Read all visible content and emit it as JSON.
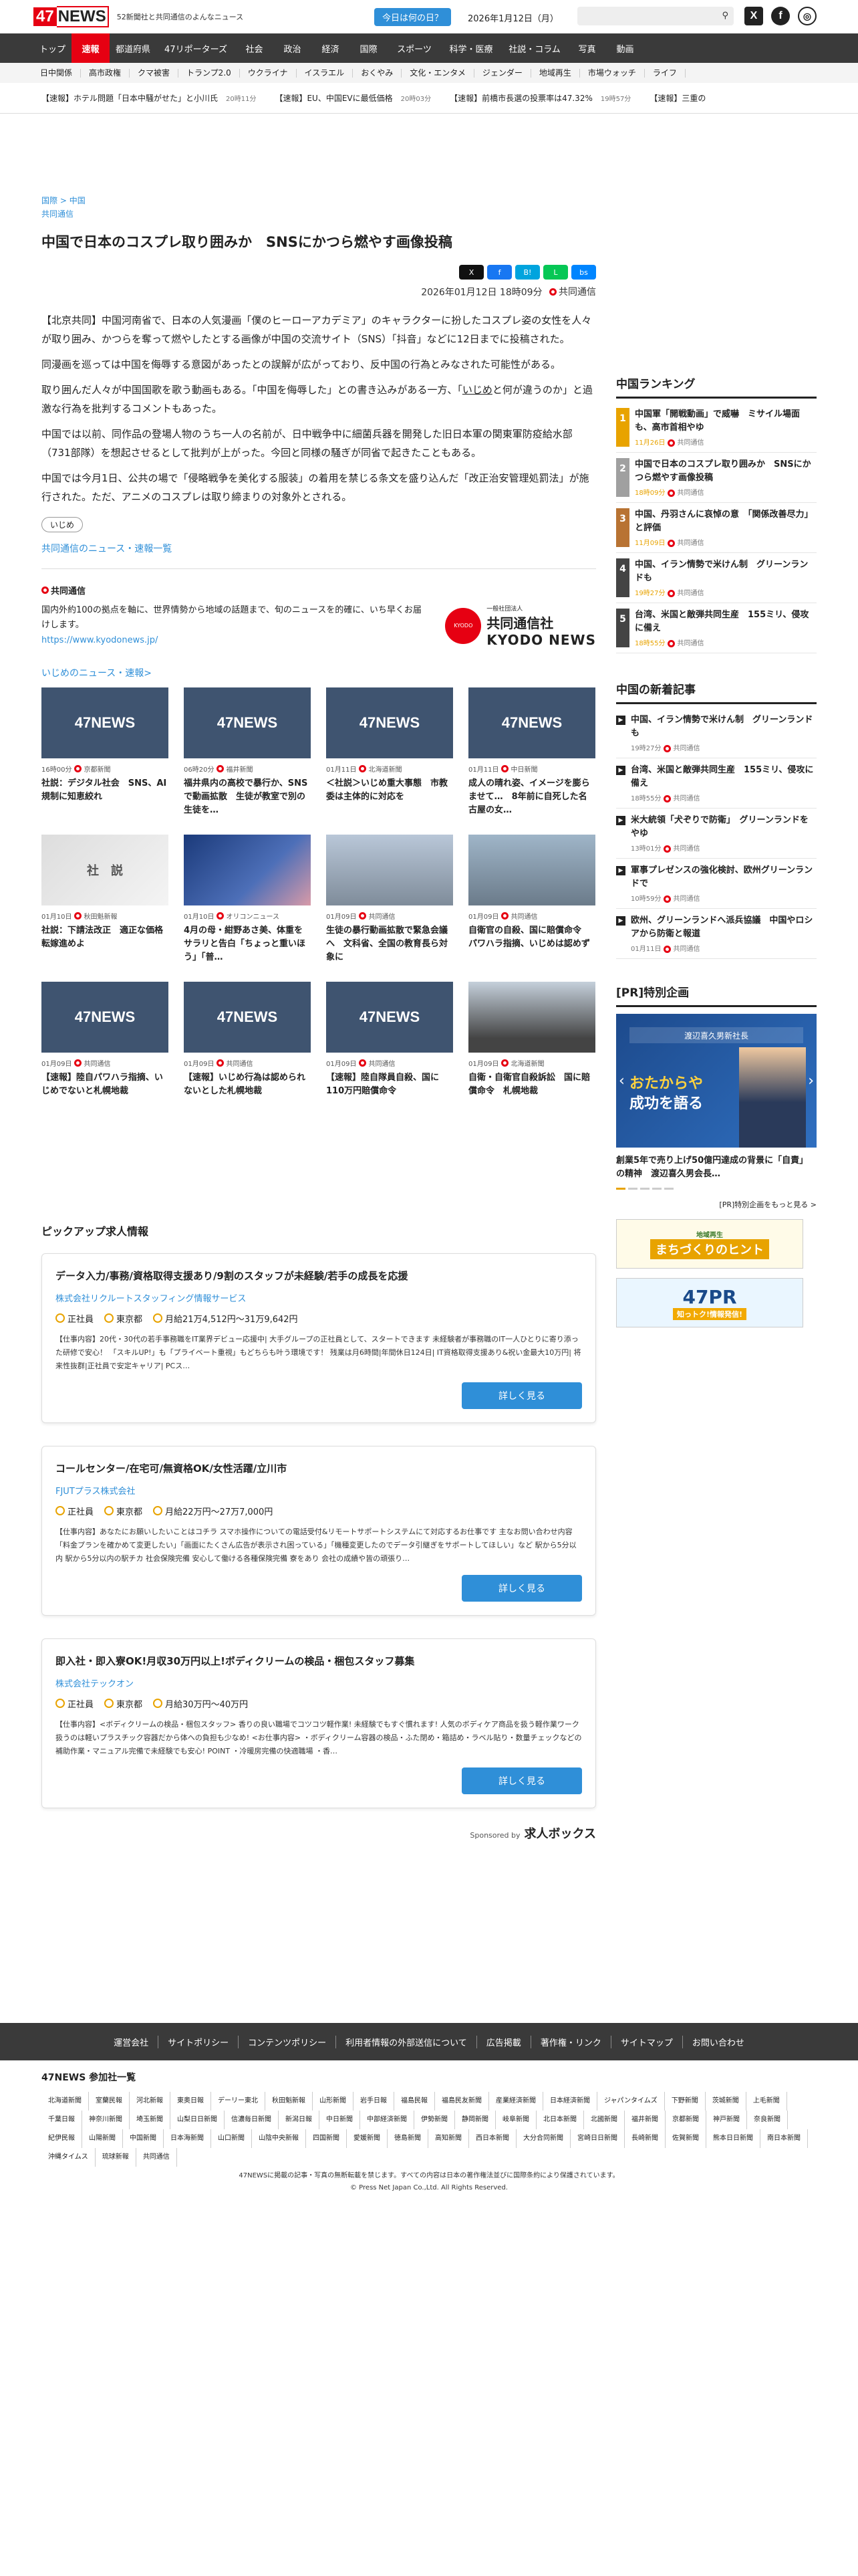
{
  "header": {
    "logo_num": "47",
    "logo_text": "NEWS",
    "tagline": "52新聞社と共同通信のよんなニュース",
    "day_button": "今日は何の日？",
    "date": "2026年1月12日（月）",
    "x_label": "X",
    "fb_label": "f"
  },
  "nav": [
    "トップ",
    "速報",
    "都道府県",
    "47リポーターズ",
    "社会",
    "政治",
    "経済",
    "国際",
    "スポーツ",
    "科学・医療",
    "社説・コラム",
    "写真",
    "動画"
  ],
  "subnav": [
    "日中関係",
    "高市政権",
    "クマ被害",
    "トランプ2.0",
    "ウクライナ",
    "イスラエル",
    "おくやみ",
    "文化・エンタメ",
    "ジェンダー",
    "地域再生",
    "市場ウォッチ",
    "ライフ"
  ],
  "ticker": [
    {
      "text": "【速報】ホテル問題「日本中騒がせた」と小川氏",
      "time": "20時11分"
    },
    {
      "text": "【速報】EU、中国EVに最低価格",
      "time": "20時03分"
    },
    {
      "text": "【速報】前橋市長選の投票率は47.32%",
      "time": "19時57分"
    },
    {
      "text": "【速報】三重の",
      "time": ""
    }
  ],
  "article": {
    "breadcrumb1": "国際",
    "breadcrumb_sep": ">",
    "breadcrumb2": "中国",
    "source_link": "共同通信",
    "title": "中国で日本のコスプレ取り囲みか　SNSにかつら燃やす画像投稿",
    "date": "2026年01月12日 18時09分",
    "agency": "共同通信",
    "share_x": "X",
    "share_fb": "f",
    "share_hb": "B!",
    "share_line": "L",
    "share_bs": "bs",
    "p1": "【北京共同】中国河南省で、日本の人気漫画「僕のヒーローアカデミア」のキャラクターに扮したコスプレ姿の女性を人々が取り囲み、かつらを奪って燃やしたとする画像が中国の交流サイト（SNS）「抖音」などに12日までに投稿された。",
    "p2": "同漫画を巡っては中国を侮辱する意図があったとの誤解が広がっており、反中国の行為とみなされた可能性がある。",
    "p3a": "取り囲んだ人々が中国国歌を歌う動画もある。「中国を侮辱した」との書き込みがある一方、「",
    "p3u": "いじめ",
    "p3b": "と何が違うのか」と過激な行為を批判するコメントもあった。",
    "p4": "中国では以前、同作品の登場人物のうち一人の名前が、日中戦争中に細菌兵器を開発した旧日本軍の関東軍防疫給水部（731部隊）を想起させるとして批判が上がった。今回と同様の騒ぎが同省で起きたこともある。",
    "p5": "中国では今月1日、公共の場で「侵略戦争を美化する服装」の着用を禁じる条文を盛り込んだ「改正治安管理処罰法」が施行された。ただ、アニメのコスプレは取り締まりの対象外とされる。",
    "keyword": "いじめ",
    "ky_news_link": "共同通信のニュース・速報一覧"
  },
  "kyodo": {
    "name": "共同通信",
    "desc": "国内外約100の拠点を軸に、世界情勢から地域の話題まで、旬のニュースを的確に、いち早くお届けします。",
    "url": "https://www.kyodonews.jp/",
    "logo_circle": "KYODO",
    "logo_small": "一般社団法人",
    "logo_jp": "共同通信社",
    "logo_en": "KYODO NEWS"
  },
  "ijime": {
    "link": "いじめのニュース・速報>",
    "cards": [
      {
        "thumb": "47NEWS",
        "date": "16時00分",
        "src": "京都新聞",
        "title": "社説：デジタル社会　SNS、AI規制に知恵絞れ"
      },
      {
        "thumb": "47NEWS",
        "date": "06時20分",
        "src": "福井新聞",
        "title": "福井県内の高校で暴行か、SNSで動画拡散　生徒が教室で別の生徒を…"
      },
      {
        "thumb": "47NEWS",
        "date": "01月11日",
        "src": "北海道新聞",
        "title": "＜社説＞いじめ重大事態　市教委は主体的に対応を"
      },
      {
        "thumb": "47NEWS",
        "date": "01月11日",
        "src": "中日新聞",
        "title": "成人の晴れ姿、イメージを膨らませて…　8年前に自死した名古屋の女…"
      },
      {
        "thumb": "社　説",
        "date": "01月10日",
        "src": "秋田魁新報",
        "title": "社説：下請法改正　適正な価格転嫁進めよ"
      },
      {
        "thumb": "",
        "date": "01月10日",
        "src": "オリコンニュース",
        "title": "4月の母・紺野あさ美、体重をサラリと告白「ちょっと重いほう」「普…"
      },
      {
        "thumb": "",
        "date": "01月09日",
        "src": "共同通信",
        "title": "生徒の暴行動画拡散で緊急会議へ　文科省、全国の教育長ら対象に"
      },
      {
        "thumb": "",
        "date": "01月09日",
        "src": "共同通信",
        "title": "自衛官の自殺、国に賠償命令　パワハラ指摘、いじめは認めず"
      },
      {
        "thumb": "47NEWS",
        "date": "01月09日",
        "src": "共同通信",
        "title": "【速報】陸自パワハラ指摘、いじめでないと札幌地裁"
      },
      {
        "thumb": "47NEWS",
        "date": "01月09日",
        "src": "共同通信",
        "title": "【速報】いじめ行為は認められないとした札幌地裁"
      },
      {
        "thumb": "47NEWS",
        "date": "01月09日",
        "src": "共同通信",
        "title": "【速報】陸自隊員自殺、国に110万円賠償命令"
      },
      {
        "thumb": "",
        "date": "01月09日",
        "src": "北海道新聞",
        "title": "自衛・自衛官自殺訴訟　国に賠償命令　札幌地裁"
      }
    ]
  },
  "jobs": {
    "heading": "ピックアップ求人情報",
    "items": [
      {
        "title": "データ入力/事務/資格取得支援あり/9割のスタッフが未経験/若手の成長を応援",
        "company": "株式会社リクルートスタッフィング情報サービス",
        "type": "正社員",
        "place": "東京都",
        "salary": "月給21万4,512円〜31万9,642円",
        "desc": "【仕事内容】20代・30代の若手事務職をIT業界デビュー応援中| 大手グループの正社員として、スタートできます 未経験者が事務職のIT一人ひとりに寄り添った研修で安心！ 「スキルUP!」も「プライベート重視」もどちらも叶う環境です！ 残業は月6時間|年間休日124日| IT資格取得支援あり&祝い金最大10万円| 将来性抜群|正社員で安定キャリア| PCス…",
        "button": "詳しく見る"
      },
      {
        "title": "コールセンター/在宅可/無資格OK/女性活躍/立川市",
        "company": "FJUTプラス株式会社",
        "type": "正社員",
        "place": "東京都",
        "salary": "月給22万円〜27万7,000円",
        "desc": "【仕事内容】あなたにお願いしたいことはコチラ スマホ操作についての電話受付&リモートサポートシステムにて対応するお仕事です 主なお問い合わせ内容「料金プランを確かめて変更したい」「画面にたくさん広告が表示され困っている」「機種変更したのでデータ引継ぎをサポートしてほしい」など 駅から5分以内 駅から5分以内の駅チカ 社会保険完備 安心して働ける各種保険完備 寮をあり 会社の成績や皆の頑張り…",
        "button": "詳しく見る"
      },
      {
        "title": "即入社・即入寮OK!月収30万円以上!ボディクリームの検品・梱包スタッフ募集",
        "company": "株式会社テックオン",
        "type": "正社員",
        "place": "東京都",
        "salary": "月給30万円〜40万円",
        "desc": "【仕事内容】<ボディクリームの検品・梱包スタッフ> 香りの良い職場でコツコツ軽作業! 未経験でもすぐ慣れます! 人気のボディケア商品を扱う軽作業ワーク 扱うのは軽いプラスチック容器だから体への負担も少なめ! <お仕事内容> ・ボディクリーム容器の検品・ふた閉め・箱詰め・ラベル貼り・数量チェックなどの補助作業・マニュアル完備で未経験でも安心! POINT ・冷暖房完備の快適職場 ・香…",
        "button": "詳しく見る"
      }
    ],
    "sponsored": "Sponsored by",
    "sponsor": "求人ボックス"
  },
  "ranking": {
    "heading": "中国ランキング",
    "items": [
      {
        "n": "1",
        "title": "中国軍「開戦動画」で威嚇　ミサイル場面も、高市首相やゆ",
        "date": "11月26日",
        "src": "共同通信",
        "color": "#e8a300"
      },
      {
        "n": "2",
        "title": "中国で日本のコスプレ取り囲みか　SNSにかつら燃やす画像投稿",
        "date": "18時09分",
        "src": "共同通信",
        "color": "#a0a0a0"
      },
      {
        "n": "3",
        "title": "中国、丹羽さんに哀悼の意　「関係改善尽力」と評価",
        "date": "11月09日",
        "src": "共同通信",
        "color": "#b87333"
      },
      {
        "n": "4",
        "title": "中国、イラン情勢で米けん制　グリーンランドも",
        "date": "19時27分",
        "src": "共同通信",
        "color": "#444"
      },
      {
        "n": "5",
        "title": "台湾、米国と敵弾共同生産　155ミリ、侵攻に備え",
        "date": "18時55分",
        "src": "共同通信",
        "color": "#444"
      }
    ]
  },
  "newest": {
    "heading": "中国の新着記事",
    "items": [
      {
        "title": "中国、イラン情勢で米けん制　グリーンランドも",
        "date": "19時27分",
        "src": "共同通信"
      },
      {
        "title": "台湾、米国と敵弾共同生産　155ミリ、侵攻に備え",
        "date": "18時55分",
        "src": "共同通信"
      },
      {
        "title": "米大統領「犬ぞりで防衛」　グリーンランドをやゆ",
        "date": "13時01分",
        "src": "共同通信"
      },
      {
        "title": "軍事プレゼンスの強化検討、欧州グリーンランドで",
        "date": "10時59分",
        "src": "共同通信"
      },
      {
        "title": "欧州、グリーンランドへ派兵協議　中国やロシアから防衛と報道",
        "date": "01月11日",
        "src": "共同通信"
      }
    ]
  },
  "pr": {
    "heading": "[PR]特別企画",
    "box_top": "渡辺喜久男新社長",
    "box_main1": "おたからや",
    "box_main2": "成功を語る",
    "caption": "創業5年で売り上げ50億円達成の背景に「自責」の精神　渡辺喜久男会長…",
    "more": "[PR]特別企画をもっと見る >",
    "banner1": "まちづくりのヒント",
    "banner1_sub": "地域再生",
    "banner2": "47PR",
    "banner2_sub": "知っトク!情報発信!"
  },
  "footer": {
    "links": [
      "運営会社",
      "サイトポリシー",
      "コンテンツポリシー",
      "利用者情報の外部送信について",
      "広告掲載",
      "著作権・リンク",
      "サイトマップ",
      "お問い合わせ"
    ],
    "pub_heading": "47NEWS 参加社一覧",
    "pubs": [
      "北海道新聞",
      "室蘭民報",
      "河北新報",
      "東奥日報",
      "デーリー東北",
      "秋田魁新報",
      "山形新聞",
      "岩手日報",
      "福島民報",
      "福島民友新聞",
      "産業経済新聞",
      "日本経済新聞",
      "ジャパンタイムズ",
      "下野新聞",
      "茨城新聞",
      "上毛新聞",
      "千葉日報",
      "神奈川新聞",
      "埼玉新聞",
      "山梨日日新聞",
      "信濃毎日新聞",
      "新潟日報",
      "中日新聞",
      "中部経済新聞",
      "伊勢新聞",
      "静岡新聞",
      "岐阜新聞",
      "北日本新聞",
      "北國新聞",
      "福井新聞",
      "京都新聞",
      "神戸新聞",
      "奈良新聞",
      "紀伊民報",
      "山陽新聞",
      "中国新聞",
      "日本海新聞",
      "山口新聞",
      "山陰中央新報",
      "四国新聞",
      "愛媛新聞",
      "徳島新聞",
      "高知新聞",
      "西日本新聞",
      "大分合同新聞",
      "宮崎日日新聞",
      "長崎新聞",
      "佐賀新聞",
      "熊本日日新聞",
      "南日本新聞",
      "沖縄タイムス",
      "琉球新報",
      "共同通信"
    ],
    "copy1": "47NEWSに掲載の記事・写真の無断転載を禁じます。すべての内容は日本の著作権法並びに国際条約により保護されています。",
    "copy2": "© Press Net Japan Co.,Ltd. All Rights Reserved."
  },
  "colors": {
    "brand_red": "#e60012",
    "link_blue": "#2f8fd8",
    "nav_dark": "#3a3a3a",
    "accent_orange": "#e8a300"
  }
}
